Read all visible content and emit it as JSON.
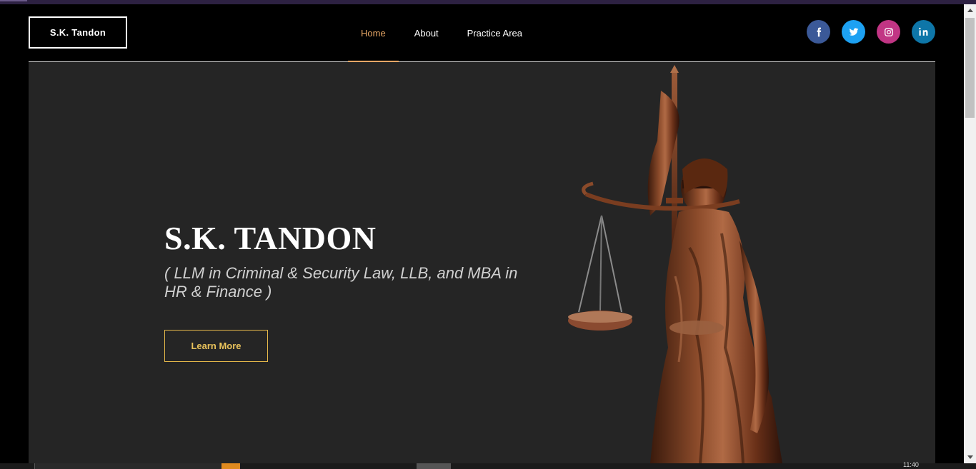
{
  "brand": {
    "logo_text": "S.K. Tandon"
  },
  "nav": {
    "items": [
      {
        "label": "Home",
        "active": true
      },
      {
        "label": "About",
        "active": false
      },
      {
        "label": "Practice Area",
        "active": false
      }
    ]
  },
  "social": {
    "icons": [
      "facebook-icon",
      "twitter-icon",
      "instagram-icon",
      "linkedin-icon"
    ],
    "colors": {
      "facebook": "#3b5998",
      "twitter": "#1da1f2",
      "instagram": "#c13584",
      "linkedin": "#0e76a8"
    }
  },
  "hero": {
    "title": "S.K. TANDON",
    "subtitle": "( LLM in Criminal & Security Law, LLB, and MBA in HR & Finance )",
    "cta_label": "Learn More",
    "image": "lady-justice-statue"
  },
  "taskbar": {
    "clock": "11:40"
  },
  "colors": {
    "accent": "#e7a766",
    "cta_border": "#e5b84a",
    "hero_bg": "#252525",
    "page_bg": "#000000"
  }
}
